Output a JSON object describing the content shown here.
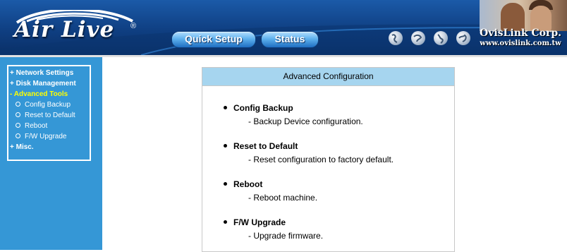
{
  "header": {
    "brand": "Air Live",
    "brand_mark": "®",
    "buttons": {
      "quick_setup": "Quick Setup",
      "status": "Status"
    },
    "company": {
      "name": "OvisLink Corp.",
      "url": "www.ovislink.com.tw"
    },
    "colors": {
      "header_blue": "#124a93",
      "button_blue": "#5fb2ee"
    }
  },
  "sidebar": {
    "items": [
      {
        "label": "+ Network Settings"
      },
      {
        "label": "+ Disk Management"
      },
      {
        "label": "- Advanced Tools",
        "active": true
      },
      {
        "label": "+ Misc."
      }
    ],
    "sub_items": [
      {
        "label": "Config Backup"
      },
      {
        "label": "Reset to Default"
      },
      {
        "label": "Reboot"
      },
      {
        "label": "F/W Upgrade"
      }
    ],
    "colors": {
      "background": "#3597d6",
      "active": "#ffff00"
    }
  },
  "main": {
    "title": "Advanced Configuration",
    "entries": [
      {
        "title": "Config Backup",
        "desc": "- Backup Device configuration."
      },
      {
        "title": "Reset to Default",
        "desc": "- Reset configuration to factory default."
      },
      {
        "title": "Reboot",
        "desc": "- Reboot machine."
      },
      {
        "title": "F/W Upgrade",
        "desc": "- Upgrade firmware."
      }
    ],
    "colors": {
      "title_bar": "#a6d5ef"
    }
  }
}
